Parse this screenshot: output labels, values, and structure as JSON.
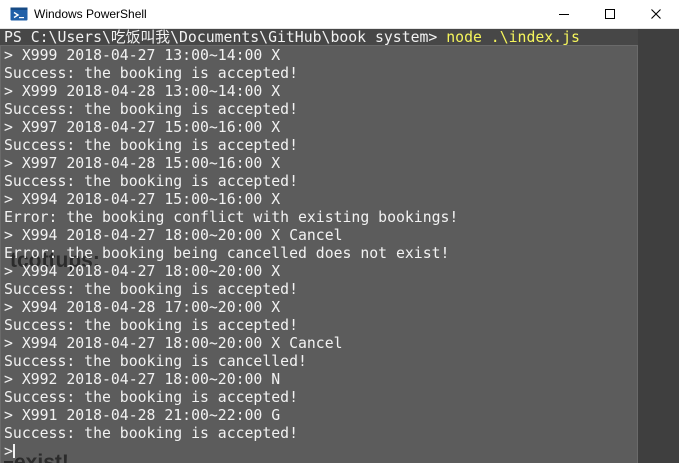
{
  "window": {
    "title": "Windows PowerShell"
  },
  "console": {
    "prompt": "PS C:\\Users\\吃饭叫我\\Documents\\GitHub\\book system> ",
    "command": "node .\\index.js",
    "lines": [
      "> X999 2018-04-27 13:00~14:00 X",
      "Success: the booking is accepted!",
      "> X999 2018-04-28 13:00~14:00 X",
      "Success: the booking is accepted!",
      "> X997 2018-04-27 15:00~16:00 X",
      "Success: the booking is accepted!",
      "> X997 2018-04-28 15:00~16:00 X",
      "Success: the booking is accepted!",
      "> X994 2018-04-27 15:00~16:00 X",
      "Error: the booking conflict with existing bookings!",
      "> X994 2018-04-27 18:00~20:00 X Cancel",
      "Error: the booking being cancelled does not exist!",
      "> X994 2018-04-27 18:00~20:00 X",
      "Success: the booking is accepted!",
      "> X994 2018-04-28 17:00~20:00 X",
      "Success: the booking is accepted!",
      "> X994 2018-04-27 18:00~20:00 X Cancel",
      "Success: the booking is cancelled!",
      "> X992 2018-04-27 18:00~20:00 N",
      "Success: the booking is accepted!",
      "> X991 2018-04-28 21:00~22:00 G",
      "Success: the booking is accepted!"
    ],
    "final_prompt": ">"
  },
  "backdrop": {
    "text_1": "tcottups:",
    "text_2": "exist!"
  }
}
